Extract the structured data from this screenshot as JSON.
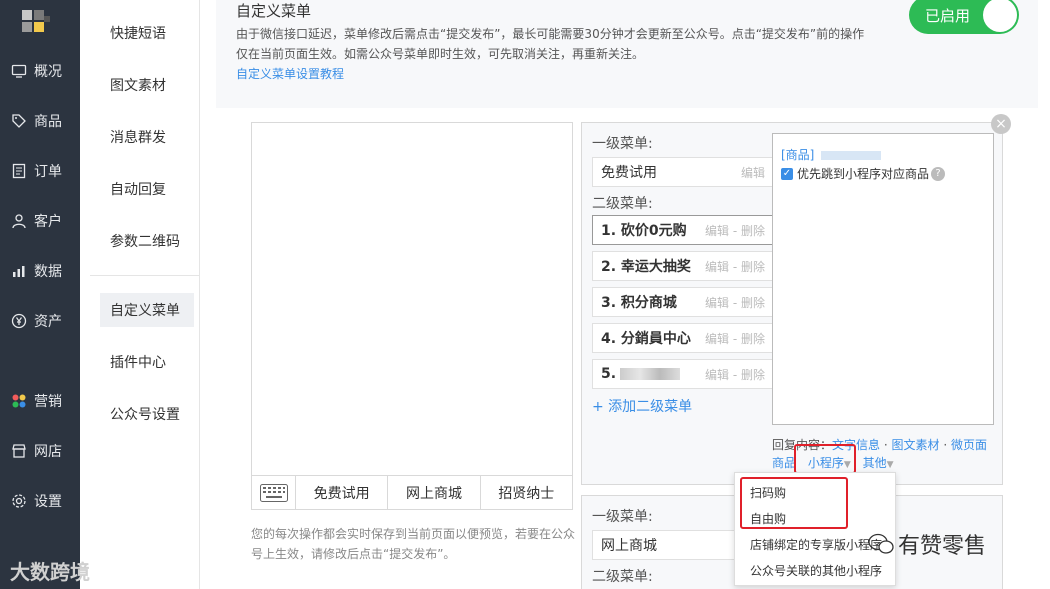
{
  "nav": {
    "items": [
      {
        "label": "概况",
        "icon": "monitor-icon"
      },
      {
        "label": "商品",
        "icon": "tag-icon"
      },
      {
        "label": "订单",
        "icon": "document-icon"
      },
      {
        "label": "客户",
        "icon": "person-icon"
      },
      {
        "label": "数据",
        "icon": "bar-chart-icon"
      },
      {
        "label": "资产",
        "icon": "yen-icon"
      },
      {
        "label": "营销",
        "icon": "colorful-dots-icon"
      },
      {
        "label": "网店",
        "icon": "store-icon"
      },
      {
        "label": "设置",
        "icon": "gear-icon"
      }
    ]
  },
  "subnav": {
    "items": [
      "快捷短语",
      "图文素材",
      "消息群发",
      "自动回复",
      "参数二维码",
      "自定义菜单",
      "插件中心",
      "公众号设置"
    ],
    "active": "自定义菜单"
  },
  "notice": {
    "title": "自定义菜单",
    "text": "由于微信接口延迟，菜单修改后需点击“提交发布”，最长可能需要30分钟才会更新至公众号。点击“提交发布”前的操作仅在当前页面生效。如需公众号菜单即时生效，可先取消关注，再重新关注。",
    "link": "自定义菜单设置教程",
    "toggle_label": "已启用"
  },
  "phone": {
    "menus": [
      "免费试用",
      "网上商城",
      "招贤纳士"
    ],
    "hint": "您的每次操作都会实时保存到当前页面以便预览，若要在公众号上生效，请修改后点击“提交发布”。"
  },
  "editor": {
    "level1_label": "一级菜单:",
    "level1_value": "免费试用",
    "edit": "编辑",
    "level2_label": "二级菜单:",
    "edit_delete": "编辑 - 删除",
    "submenus": [
      "1. 砍价0元购",
      "2. 幸运大抽奖",
      "3. 积分商城",
      "4. 分銷員中心",
      "5."
    ],
    "add_sub": "+ 添加二级菜单",
    "content_tag": "[商品]",
    "checkbox_label": "优先跳到小程序对应商品",
    "reply_label": "回复内容：",
    "reply_types": [
      "文字信息",
      "图文素材",
      "微页面"
    ],
    "reply_types2": [
      "商品",
      "小程序",
      "其他"
    ],
    "close": "×"
  },
  "editor2": {
    "level1_label": "一级菜单:",
    "level1_value": "网上商城",
    "level2_label": "二级菜单:"
  },
  "dropdown": {
    "items": [
      "扫码购",
      "自由购",
      "店铺绑定的专享版小程序",
      "公众号关联的其他小程序"
    ]
  },
  "watermarks": {
    "left": "大数跨境",
    "right": "有赞零售"
  },
  "colors": {
    "nav_bg": "#2c3440",
    "accent_green": "#2dbb55",
    "link_blue": "#3a8ee6",
    "highlight_red": "#e0202a"
  }
}
